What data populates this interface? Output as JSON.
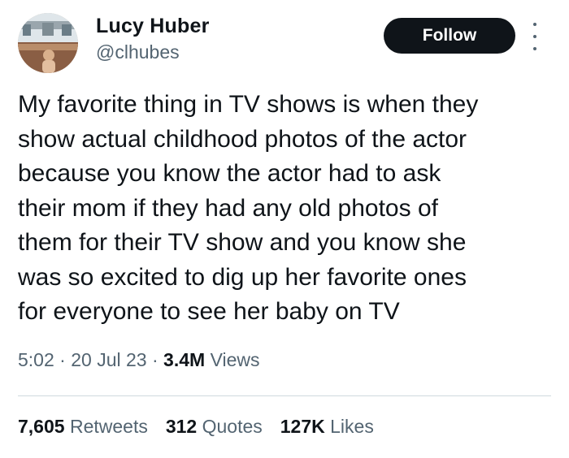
{
  "author": {
    "display_name": "Lucy Huber",
    "handle": "@clhubes",
    "avatar_icon": "profile-photo"
  },
  "follow_button_label": "Follow",
  "more_icon": "more-vertical-icon",
  "tweet": {
    "lines": [
      "My favorite thing in TV shows is when they",
      "show actual childhood photos of the actor",
      "because you know the actor had to ask",
      "their mom if they had any old photos of",
      "them for their TV show and you know she",
      "was so excited to dig up her favorite ones",
      "for everyone to see her baby on TV"
    ]
  },
  "meta": {
    "time": "5:02",
    "date": "20 Jul 23",
    "views_count": "3.4M",
    "views_label": "Views",
    "separator": "·"
  },
  "stats": {
    "retweets_count": "7,605",
    "retweets_label": "Retweets",
    "quotes_count": "312",
    "quotes_label": "Quotes",
    "likes_count": "127K",
    "likes_label": "Likes"
  },
  "colors": {
    "text": "#0f1419",
    "secondary": "#536471",
    "button_bg": "#0f1419",
    "divider": "#cfd9de"
  }
}
